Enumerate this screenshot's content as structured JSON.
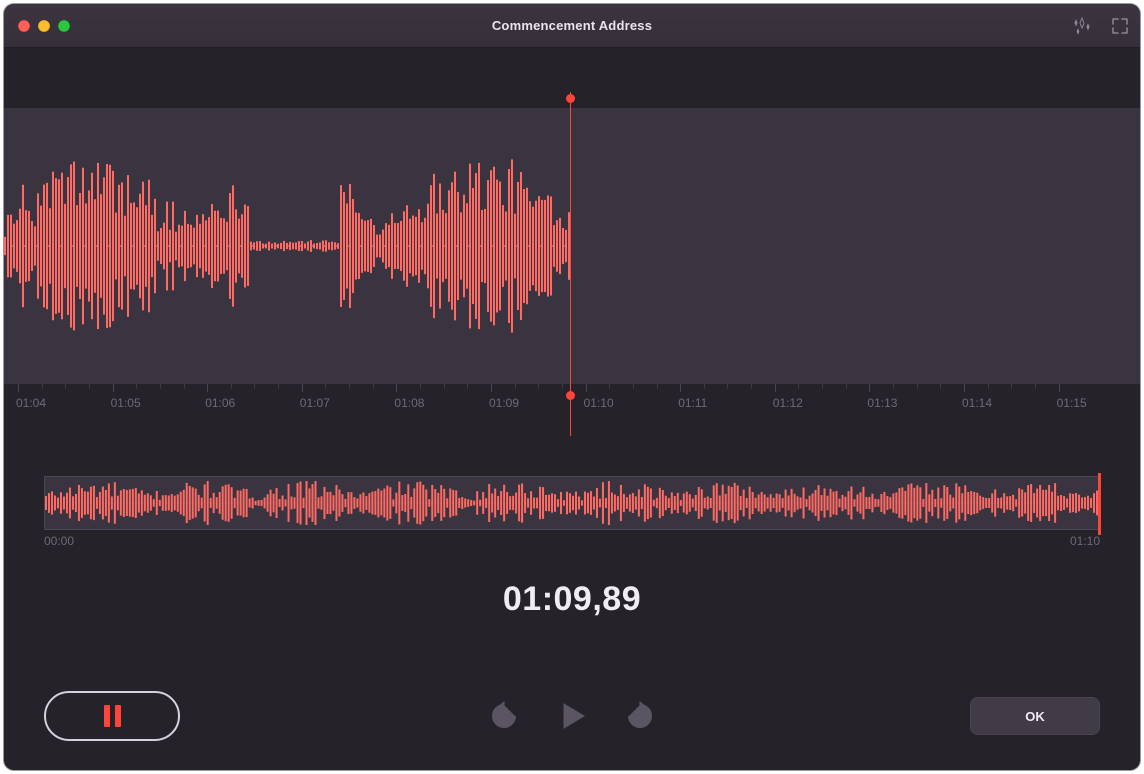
{
  "window": {
    "title": "Commencement Address"
  },
  "ruler": {
    "ticks": [
      "01:04",
      "01:05",
      "01:06",
      "01:07",
      "01:08",
      "01:09",
      "01:10",
      "01:11",
      "01:12",
      "01:13",
      "01:14",
      "01:15"
    ]
  },
  "overview": {
    "start_label": "00:00",
    "end_label": "01:10"
  },
  "time": {
    "current": "01:09,89"
  },
  "controls": {
    "ok_label": "OK",
    "skip_seconds": "15"
  },
  "colors": {
    "accent": "#ff453a"
  }
}
